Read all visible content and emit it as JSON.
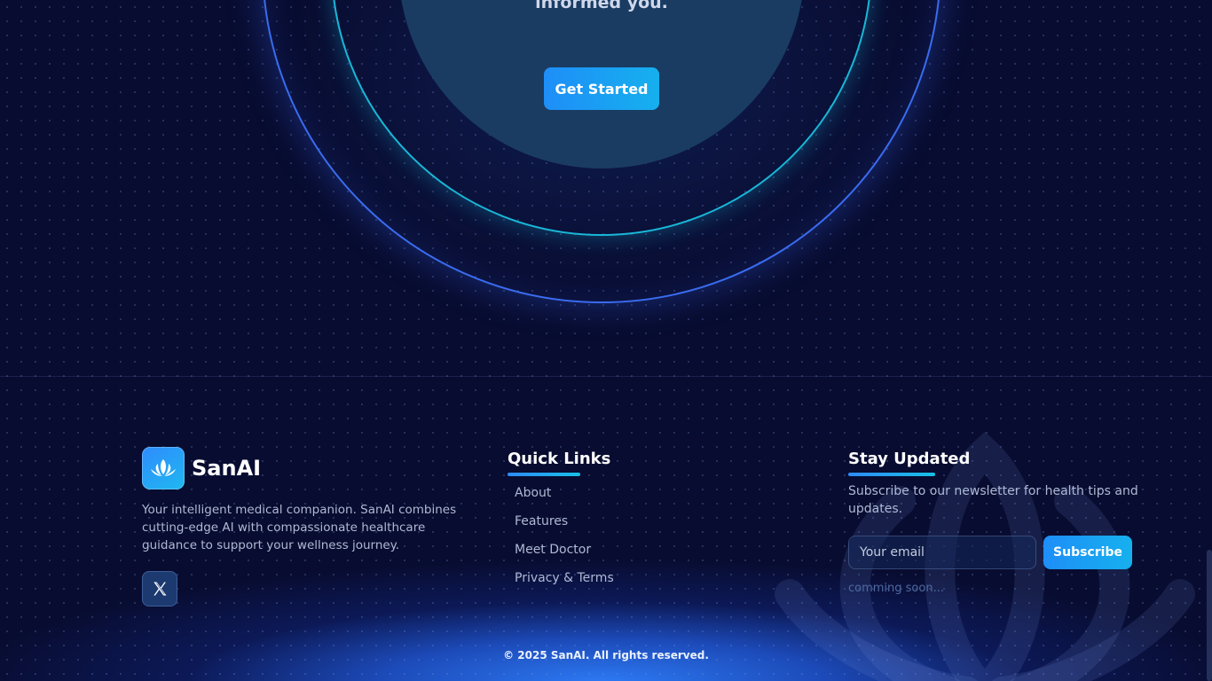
{
  "hero": {
    "text_fragment": "informed you.",
    "cta_label": "Get Started"
  },
  "brand": {
    "name": "SanAI",
    "logo_icon": "lotus-icon",
    "description": "Your intelligent medical companion. SanAI combines cutting-edge AI with compassionate healthcare guidance to support your wellness journey.",
    "social": [
      {
        "icon": "x-twitter-icon"
      }
    ]
  },
  "quick_links": {
    "title": "Quick Links",
    "items": [
      {
        "label": "About"
      },
      {
        "label": "Features"
      },
      {
        "label": "Meet Doctor"
      },
      {
        "label": "Privacy & Terms"
      }
    ]
  },
  "newsletter": {
    "title": "Stay Updated",
    "description": "Subscribe to our newsletter for health tips and updates.",
    "email_placeholder": "Your email",
    "button_label": "Subscribe",
    "note": "comming soon..."
  },
  "footer": {
    "copyright": "© 2025 SanAI. All rights reserved."
  },
  "colors": {
    "background": "#080c30",
    "accent": "#1e8ef8",
    "accent_alt": "#16b0ee",
    "ring_outer": "#3a6cf0",
    "ring_inner": "#19b7d8"
  }
}
